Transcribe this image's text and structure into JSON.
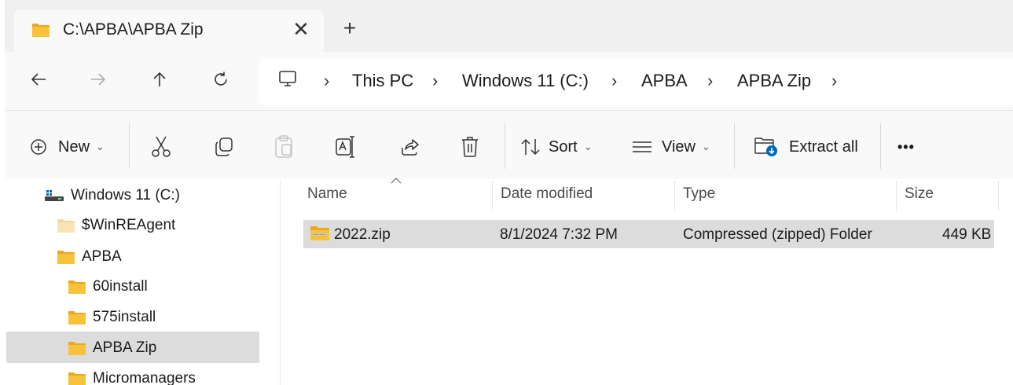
{
  "tab": {
    "title": "C:\\APBA\\APBA Zip",
    "close_glyph": "✕",
    "new_glyph": "+",
    "icon": "folder-icon"
  },
  "nav": {
    "back_icon": "arrow-left-icon",
    "forward_icon": "arrow-right-icon",
    "up_icon": "arrow-up-icon",
    "refresh_icon": "refresh-icon"
  },
  "address": {
    "root_icon": "monitor-icon",
    "crumbs": [
      "This PC",
      "Windows 11 (C:)",
      "APBA",
      "APBA Zip"
    ],
    "separator": "›"
  },
  "toolbar": {
    "new_label": "New",
    "sort_label": "Sort",
    "view_label": "View",
    "extract_label": "Extract all",
    "more_label": "•••",
    "chevron": "⌄"
  },
  "tree": [
    {
      "label": "Windows 11 (C:)",
      "icon": "drive-icon"
    },
    {
      "label": "$WinREAgent",
      "icon": "folder-icon"
    },
    {
      "label": "APBA",
      "icon": "folder-icon"
    },
    {
      "label": "60install",
      "icon": "folder-icon"
    },
    {
      "label": "575install",
      "icon": "folder-icon"
    },
    {
      "label": "APBA Zip",
      "icon": "folder-icon",
      "selected": true
    },
    {
      "label": "Micromanagers",
      "icon": "folder-icon"
    }
  ],
  "columns": {
    "name": "Name",
    "date": "Date modified",
    "type": "Type",
    "size": "Size"
  },
  "files": [
    {
      "name": "2022.zip",
      "date": "8/1/2024 7:32 PM",
      "type": "Compressed (zipped) Folder",
      "size": "449 KB",
      "icon": "zip-folder-icon"
    }
  ],
  "colors": {
    "folder": "#f8c33b",
    "folder_dark": "#e8a820",
    "accent": "#0067c0",
    "selection": "#dcdcdc"
  }
}
